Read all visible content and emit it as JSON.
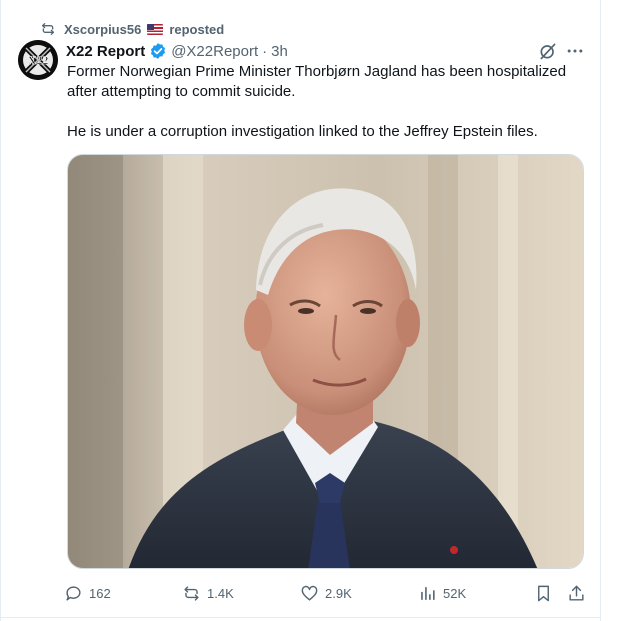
{
  "repost": {
    "reposter_name": "Xscorpius56",
    "flag": "flag-us-icon",
    "suffix": "reposted"
  },
  "author": {
    "display_name": "X22 Report",
    "handle": "@X22Report",
    "separator": "·",
    "time": "3h",
    "verified": true,
    "verified_color": "#1d9bf0",
    "avatar_text": "X22"
  },
  "tweet": {
    "paragraphs": [
      "Former Norwegian Prime Minister Thorbjørn Jagland has been hospitalized after attempting to commit suicide.",
      "He is under a corruption investigation linked to the Jeffrey Epstein files."
    ]
  },
  "media": {
    "kind": "photo"
  },
  "actions": {
    "replies": "162",
    "reposts": "1.4K",
    "likes": "2.9K",
    "views": "52K"
  },
  "colors": {
    "text": "#0f1419",
    "muted": "#536471",
    "border": "#cfd9de"
  }
}
